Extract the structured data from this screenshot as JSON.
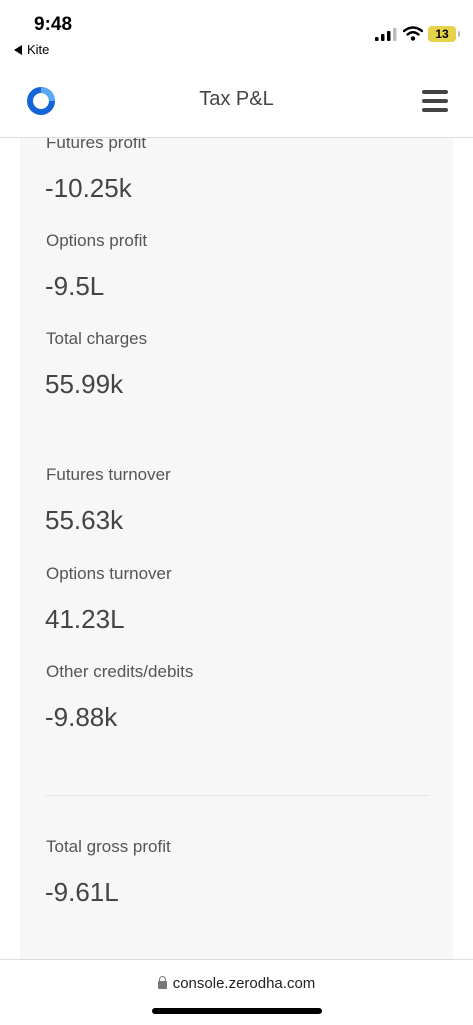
{
  "status_bar": {
    "time": "9:48",
    "back_label": "Kite",
    "battery": "13"
  },
  "header": {
    "title": "Tax P&L"
  },
  "stats": {
    "futures_profit": {
      "label": "Futures profit",
      "value": "-10.25k"
    },
    "options_profit": {
      "label": "Options profit",
      "value": "-9.5L"
    },
    "total_charges": {
      "label": "Total charges",
      "value": "55.99k"
    },
    "futures_turnover": {
      "label": "Futures turnover",
      "value": "55.63k"
    },
    "options_turnover": {
      "label": "Options turnover",
      "value": "41.23L"
    },
    "other_credits_debits": {
      "label": "Other credits/debits",
      "value": "-9.88k"
    },
    "total_gross_profit": {
      "label": "Total gross profit",
      "value": "-9.61L"
    }
  },
  "url_bar": {
    "domain": "console.zerodha.com"
  },
  "colors": {
    "brand_blue": "#387ed1",
    "card_background": "#f7f7f7",
    "text": "#444444",
    "battery": "#e6d34a"
  }
}
